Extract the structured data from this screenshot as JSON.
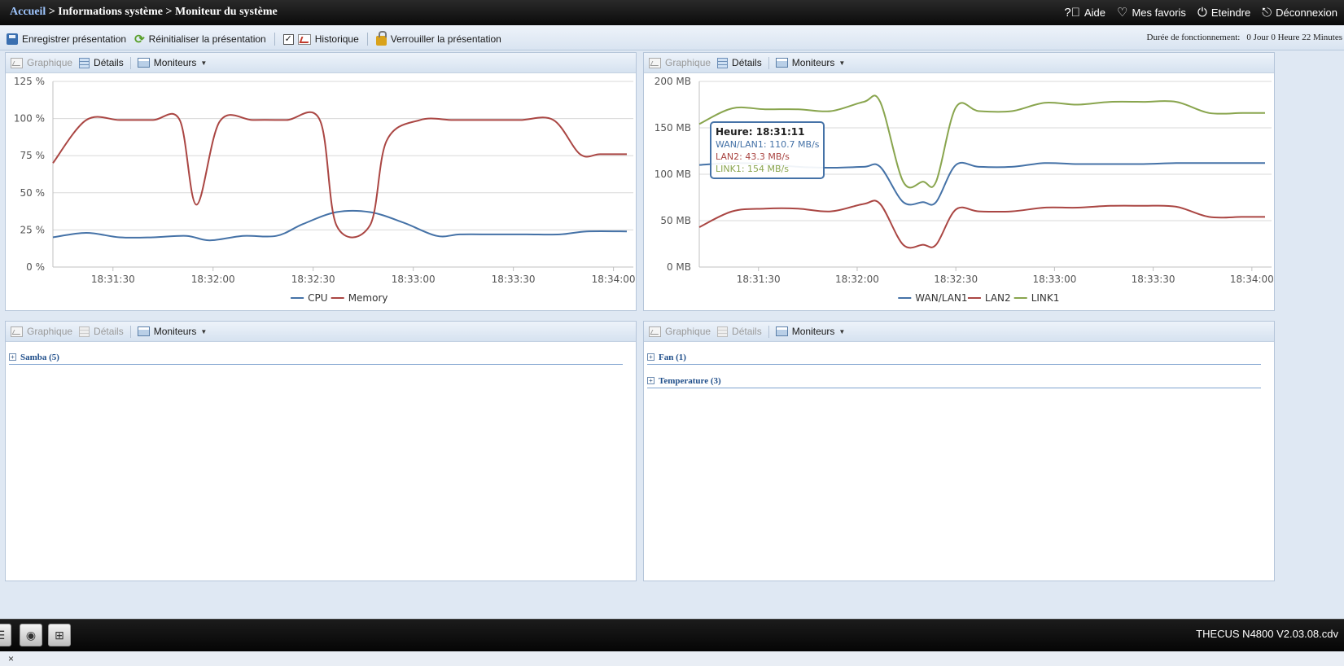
{
  "header": {
    "breadcrumb_home": "Accueil",
    "breadcrumb_rest": " > Informations système > Moniteur du système",
    "links": [
      {
        "icon": "help-icon",
        "label": "Aide"
      },
      {
        "icon": "heart-icon",
        "label": "Mes favoris"
      },
      {
        "icon": "power-icon",
        "label": "Eteindre"
      },
      {
        "icon": "logout-icon",
        "label": "Déconnexion"
      }
    ]
  },
  "toolbar": {
    "save": "Enregistrer présentation",
    "reset": "Réinitialiser la présentation",
    "history": "Historique",
    "lock": "Verrouiller la présentation",
    "uptime_label": "Durée de fonctionnement:",
    "uptime_value": "0 Jour 0 Heure 22 Minutes"
  },
  "panel_labels": {
    "graph": "Graphique",
    "details": "Détails",
    "monitors": "Moniteurs"
  },
  "tree": {
    "samba": "Samba (5)",
    "fan": "Fan (1)",
    "temperature": "Temperature (3)"
  },
  "footer": {
    "version": "THECUS N4800 V2.03.08.cdv",
    "close": "×"
  },
  "colors": {
    "blue": "#4572a7",
    "red": "#aa4643",
    "green": "#89a54e"
  },
  "chart_data": [
    {
      "type": "line",
      "x_ticks": [
        "18:31:30",
        "18:32:00",
        "18:32:30",
        "18:33:00",
        "18:33:30",
        "18:34:00"
      ],
      "y_ticks": [
        "0 %",
        "25 %",
        "50 %",
        "75 %",
        "100 %",
        "125 %"
      ],
      "ylim": [
        0,
        125
      ],
      "x_range_seconds": [
        0,
        172
      ],
      "x_tick_seconds": [
        18,
        48,
        78,
        108,
        138,
        168
      ],
      "grid": true,
      "legend": "bottom-center",
      "series": [
        {
          "name": "CPU",
          "color": "#4572a7",
          "x": [
            0,
            10,
            20,
            30,
            40,
            47,
            57,
            67,
            75,
            85,
            95,
            105,
            115,
            122,
            132,
            142,
            152,
            160,
            172
          ],
          "y": [
            20,
            23,
            20,
            20,
            21,
            18,
            21,
            21,
            29,
            37,
            37,
            30,
            21,
            22,
            22,
            22,
            22,
            24,
            24
          ]
        },
        {
          "name": "Memory",
          "color": "#aa4643",
          "x": [
            0,
            10,
            20,
            30,
            38,
            43,
            50,
            60,
            70,
            80,
            85,
            95,
            100,
            110,
            120,
            130,
            140,
            150,
            158,
            164,
            172
          ],
          "y": [
            70,
            99,
            99,
            99,
            99,
            42,
            98,
            99,
            99,
            99,
            28,
            28,
            85,
            99,
            99,
            99,
            99,
            99,
            76,
            76,
            76
          ]
        }
      ]
    },
    {
      "type": "line",
      "x_ticks": [
        "18:31:30",
        "18:32:00",
        "18:32:30",
        "18:33:00",
        "18:33:30",
        "18:34:00"
      ],
      "y_ticks": [
        "0 MB",
        "50 MB",
        "100 MB",
        "150 MB",
        "200 MB"
      ],
      "ylim": [
        0,
        200
      ],
      "x_range_seconds": [
        0,
        172
      ],
      "x_tick_seconds": [
        18,
        48,
        78,
        108,
        138,
        168
      ],
      "grid": true,
      "legend": "bottom-center",
      "series": [
        {
          "name": "WAN/LAN1",
          "color": "#4572a7",
          "x": [
            0,
            10,
            20,
            30,
            40,
            50,
            55,
            62,
            68,
            72,
            78,
            85,
            95,
            105,
            115,
            125,
            135,
            145,
            155,
            165,
            172
          ],
          "y": [
            110,
            112,
            111,
            108,
            107,
            108,
            108,
            70,
            70,
            70,
            110,
            108,
            108,
            112,
            111,
            111,
            111,
            112,
            112,
            112,
            112
          ]
        },
        {
          "name": "LAN2",
          "color": "#aa4643",
          "x": [
            0,
            10,
            20,
            30,
            40,
            50,
            55,
            62,
            68,
            72,
            78,
            85,
            95,
            105,
            115,
            125,
            135,
            145,
            155,
            165,
            172
          ],
          "y": [
            43,
            60,
            63,
            63,
            60,
            68,
            68,
            24,
            24,
            24,
            62,
            60,
            60,
            64,
            64,
            66,
            66,
            65,
            54,
            54,
            54
          ]
        },
        {
          "name": "LINK1",
          "color": "#89a54e",
          "x": [
            0,
            10,
            20,
            30,
            40,
            50,
            55,
            62,
            68,
            72,
            78,
            85,
            95,
            105,
            115,
            125,
            135,
            145,
            155,
            165,
            172
          ],
          "y": [
            154,
            171,
            170,
            170,
            168,
            178,
            178,
            92,
            92,
            92,
            172,
            168,
            168,
            177,
            175,
            178,
            178,
            178,
            166,
            166,
            166
          ]
        }
      ],
      "tooltip": {
        "title": "Heure: 18:31:11",
        "lines": [
          {
            "label": "WAN/LAN1: 110.7 MB/s",
            "color": "#4572a7"
          },
          {
            "label": "LAN2: 43.3 MB/s",
            "color": "#aa4643"
          },
          {
            "label": "LINK1: 154 MB/s",
            "color": "#89a54e"
          }
        ]
      }
    }
  ]
}
